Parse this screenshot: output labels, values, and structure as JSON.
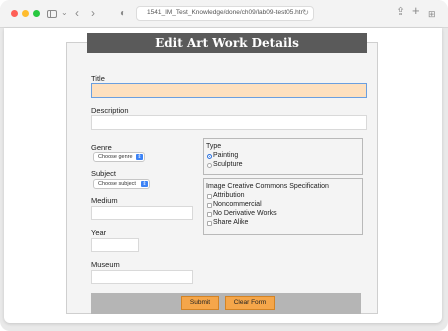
{
  "browser": {
    "address": "1541_IM_Test_Knowledge/done/ch09/lab09-test05.html"
  },
  "form": {
    "title": "Edit Art Work Details",
    "fields": {
      "title_label": "Title",
      "title_value": "",
      "description_label": "Description",
      "genre_label": "Genre",
      "genre_select": "Choose genre",
      "subject_label": "Subject",
      "subject_select": "Choose subject",
      "medium_label": "Medium",
      "year_label": "Year",
      "museum_label": "Museum"
    },
    "type_group": {
      "label": "Type",
      "options": [
        {
          "label": "Painting",
          "checked": true
        },
        {
          "label": "Sculpture",
          "checked": false
        }
      ]
    },
    "license_group": {
      "label": "Image Creative Commons Specification",
      "options": [
        {
          "label": "Attribution"
        },
        {
          "label": "Noncommercial"
        },
        {
          "label": "No Derivative Works"
        },
        {
          "label": "Share Alike"
        }
      ]
    },
    "buttons": {
      "submit": "Submit",
      "clear": "Clear Form"
    }
  },
  "colors": {
    "title_bar": "#5a5a5a",
    "button": "#f5a64a",
    "title_input": "#fde0bf",
    "focus_ring": "#6a9fe0"
  }
}
